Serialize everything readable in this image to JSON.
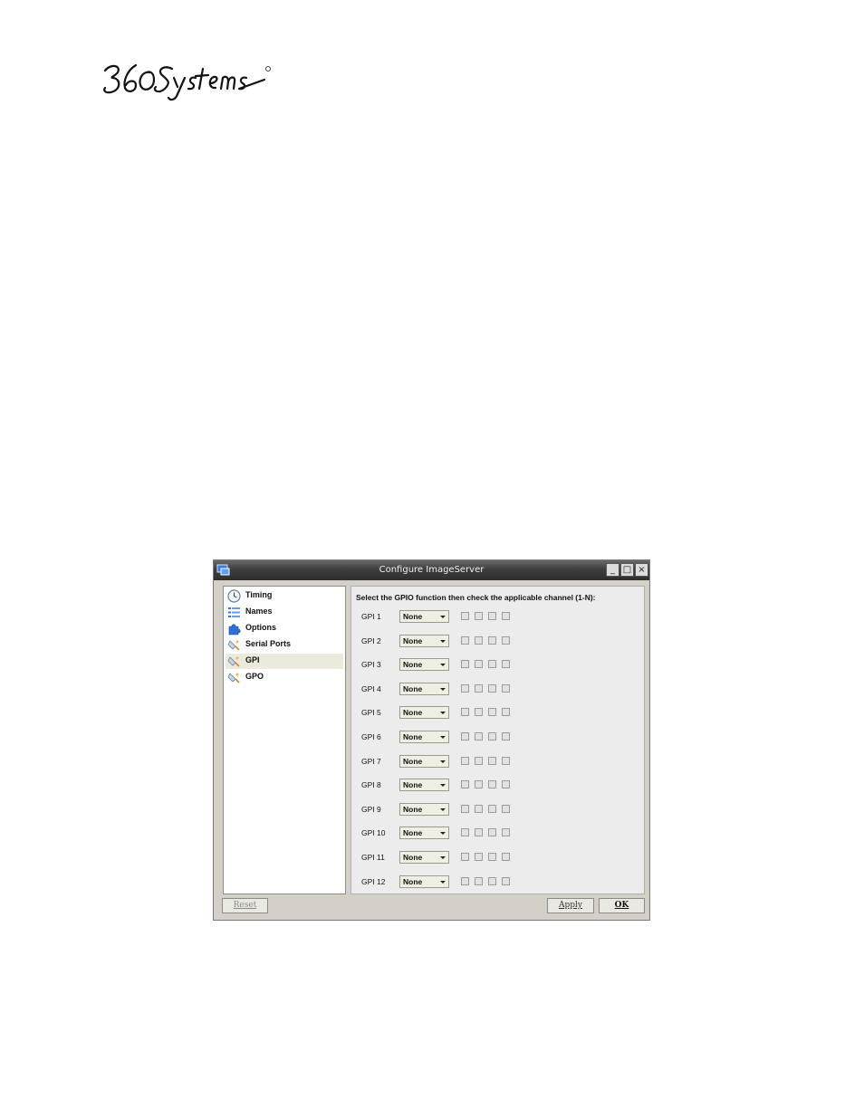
{
  "logo": {
    "text": "360 Systems"
  },
  "window": {
    "title": "Configure ImageServer",
    "controls": {
      "minimize": "_",
      "maximize": "□",
      "close": "×"
    }
  },
  "sidebar": {
    "items": [
      {
        "label": "Timing",
        "icon": "clock-icon",
        "selected": false
      },
      {
        "label": "Names",
        "icon": "list-icon",
        "selected": false
      },
      {
        "label": "Options",
        "icon": "puzzle-icon",
        "selected": false
      },
      {
        "label": "Serial Ports",
        "icon": "plug-icon",
        "selected": false
      },
      {
        "label": "GPI",
        "icon": "plug-icon",
        "selected": true
      },
      {
        "label": "GPO",
        "icon": "plug-icon",
        "selected": false
      }
    ]
  },
  "main": {
    "instruction": "Select the GPIO function then check the applicable channel (1-N):",
    "gpi_rows": [
      {
        "label": "GPI 1",
        "function": "None"
      },
      {
        "label": "GPI 2",
        "function": "None"
      },
      {
        "label": "GPI 3",
        "function": "None"
      },
      {
        "label": "GPI 4",
        "function": "None"
      },
      {
        "label": "GPI 5",
        "function": "None"
      },
      {
        "label": "GPI 6",
        "function": "None"
      },
      {
        "label": "GPI 7",
        "function": "None"
      },
      {
        "label": "GPI 8",
        "function": "None"
      },
      {
        "label": "GPI 9",
        "function": "None"
      },
      {
        "label": "GPI 10",
        "function": "None"
      },
      {
        "label": "GPI 11",
        "function": "None"
      },
      {
        "label": "GPI 12",
        "function": "None"
      }
    ]
  },
  "buttons": {
    "reset": "Reset",
    "apply": "Apply",
    "ok": "OK"
  }
}
